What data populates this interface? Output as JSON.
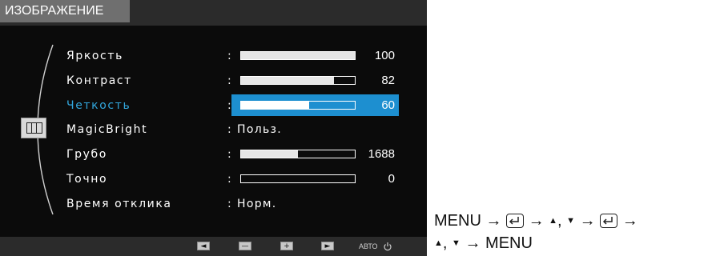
{
  "osd": {
    "title": "ИЗОБРАЖЕНИЕ",
    "items": [
      {
        "label": "Яркость",
        "type": "slider",
        "value": 100,
        "max": 100,
        "display": "100",
        "selected": false
      },
      {
        "label": "Контраст",
        "type": "slider",
        "value": 82,
        "max": 100,
        "display": "82",
        "selected": false
      },
      {
        "label": "Четкость",
        "type": "slider",
        "value": 60,
        "max": 100,
        "display": "60",
        "selected": true
      },
      {
        "label": "MagicBright",
        "type": "text",
        "display": "Польз.",
        "selected": false
      },
      {
        "label": "Грубо",
        "type": "slider",
        "value": 50,
        "max": 100,
        "display": "1688",
        "selected": false
      },
      {
        "label": "Точно",
        "type": "slider",
        "value": 0,
        "max": 100,
        "display": "0",
        "selected": false
      },
      {
        "label": "Время отклика",
        "type": "text",
        "display": "Норм.",
        "selected": false
      }
    ],
    "colon": ":",
    "footer": {
      "buttons": [
        {
          "name": "left-arrow",
          "glyph": "◄"
        },
        {
          "name": "minus",
          "glyph": "—"
        },
        {
          "name": "plus",
          "glyph": "+"
        },
        {
          "name": "right-arrow",
          "glyph": "►"
        }
      ],
      "auto_label": "АВТО",
      "power_icon": "power-icon"
    },
    "colors": {
      "background": "#0b0b0b",
      "highlight": "#1d8fd0",
      "selected_label": "#32a6dc"
    }
  },
  "instruction": {
    "line1": [
      "MENU",
      "→",
      "enter-key",
      "→",
      "▲",
      ",",
      "▼",
      "→",
      "enter-key",
      "→"
    ],
    "line2": [
      "▲",
      ",",
      "▼",
      "→",
      "MENU"
    ]
  }
}
